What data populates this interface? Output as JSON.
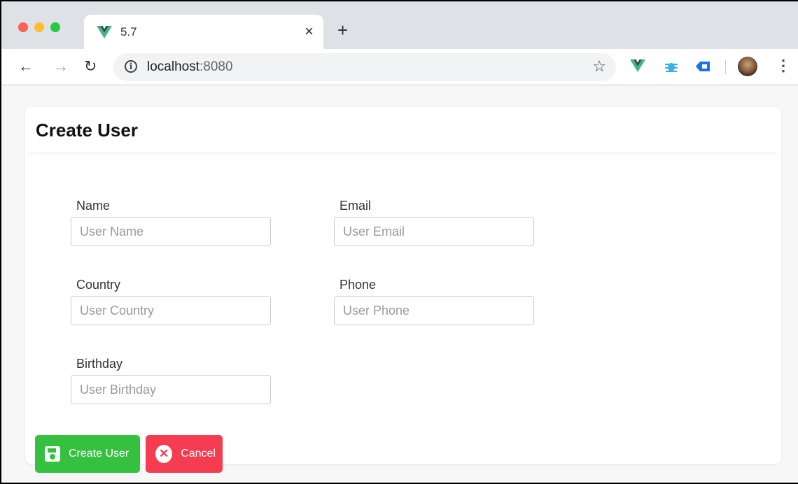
{
  "browser": {
    "tab_title": "5.7",
    "tab_close": "×",
    "new_tab": "+",
    "url_host": "localhost",
    "url_port": ":8080",
    "traffic_lights": [
      "#fe5f57",
      "#febc2e",
      "#28c840"
    ],
    "vue_color": "#41b883",
    "vue_dark": "#35495e"
  },
  "page": {
    "title": "Create User"
  },
  "form": {
    "name": {
      "label": "Name",
      "placeholder": "User Name"
    },
    "email": {
      "label": "Email",
      "placeholder": "User Email"
    },
    "country": {
      "label": "Country",
      "placeholder": "User Country"
    },
    "phone": {
      "label": "Phone",
      "placeholder": "User Phone"
    },
    "birthday": {
      "label": "Birthday",
      "placeholder": "User Birthday"
    }
  },
  "actions": {
    "create_label": "Create User",
    "cancel_label": "Cancel",
    "create_color": "#35c040",
    "cancel_color": "#f63c51"
  }
}
